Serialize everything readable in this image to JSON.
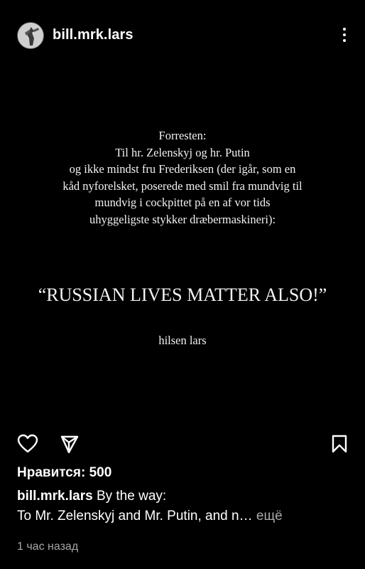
{
  "header": {
    "username": "bill.mrk.lars",
    "avatar_icon": "profile-photo",
    "more_icon": "more-vertical-icon"
  },
  "post_image": {
    "lines": [
      "Forresten:",
      "Til hr. Zelenskyj og hr. Putin",
      "og ikke mindst fru Frederiksen (der igår, som en",
      "kåd nyforelsket, poserede med smil fra mundvig til",
      "mundvig i cockpittet på en af vor tids",
      "uhyggeligste stykker dræbermaskineri):"
    ],
    "slogan": "“RUSSIAN LIVES MATTER ALSO!”",
    "signoff": "hilsen lars"
  },
  "actions": {
    "like_icon": "heart-icon",
    "share_icon": "send-icon",
    "save_icon": "bookmark-icon"
  },
  "likes": {
    "text": "Нравится: 500"
  },
  "caption": {
    "author": "bill.mrk.lars",
    "line1": "By the way:",
    "line2": "To Mr. Zelenskyj and Mr. Putin, and n…",
    "more": "ещё"
  },
  "timestamp": "1 час назад"
}
